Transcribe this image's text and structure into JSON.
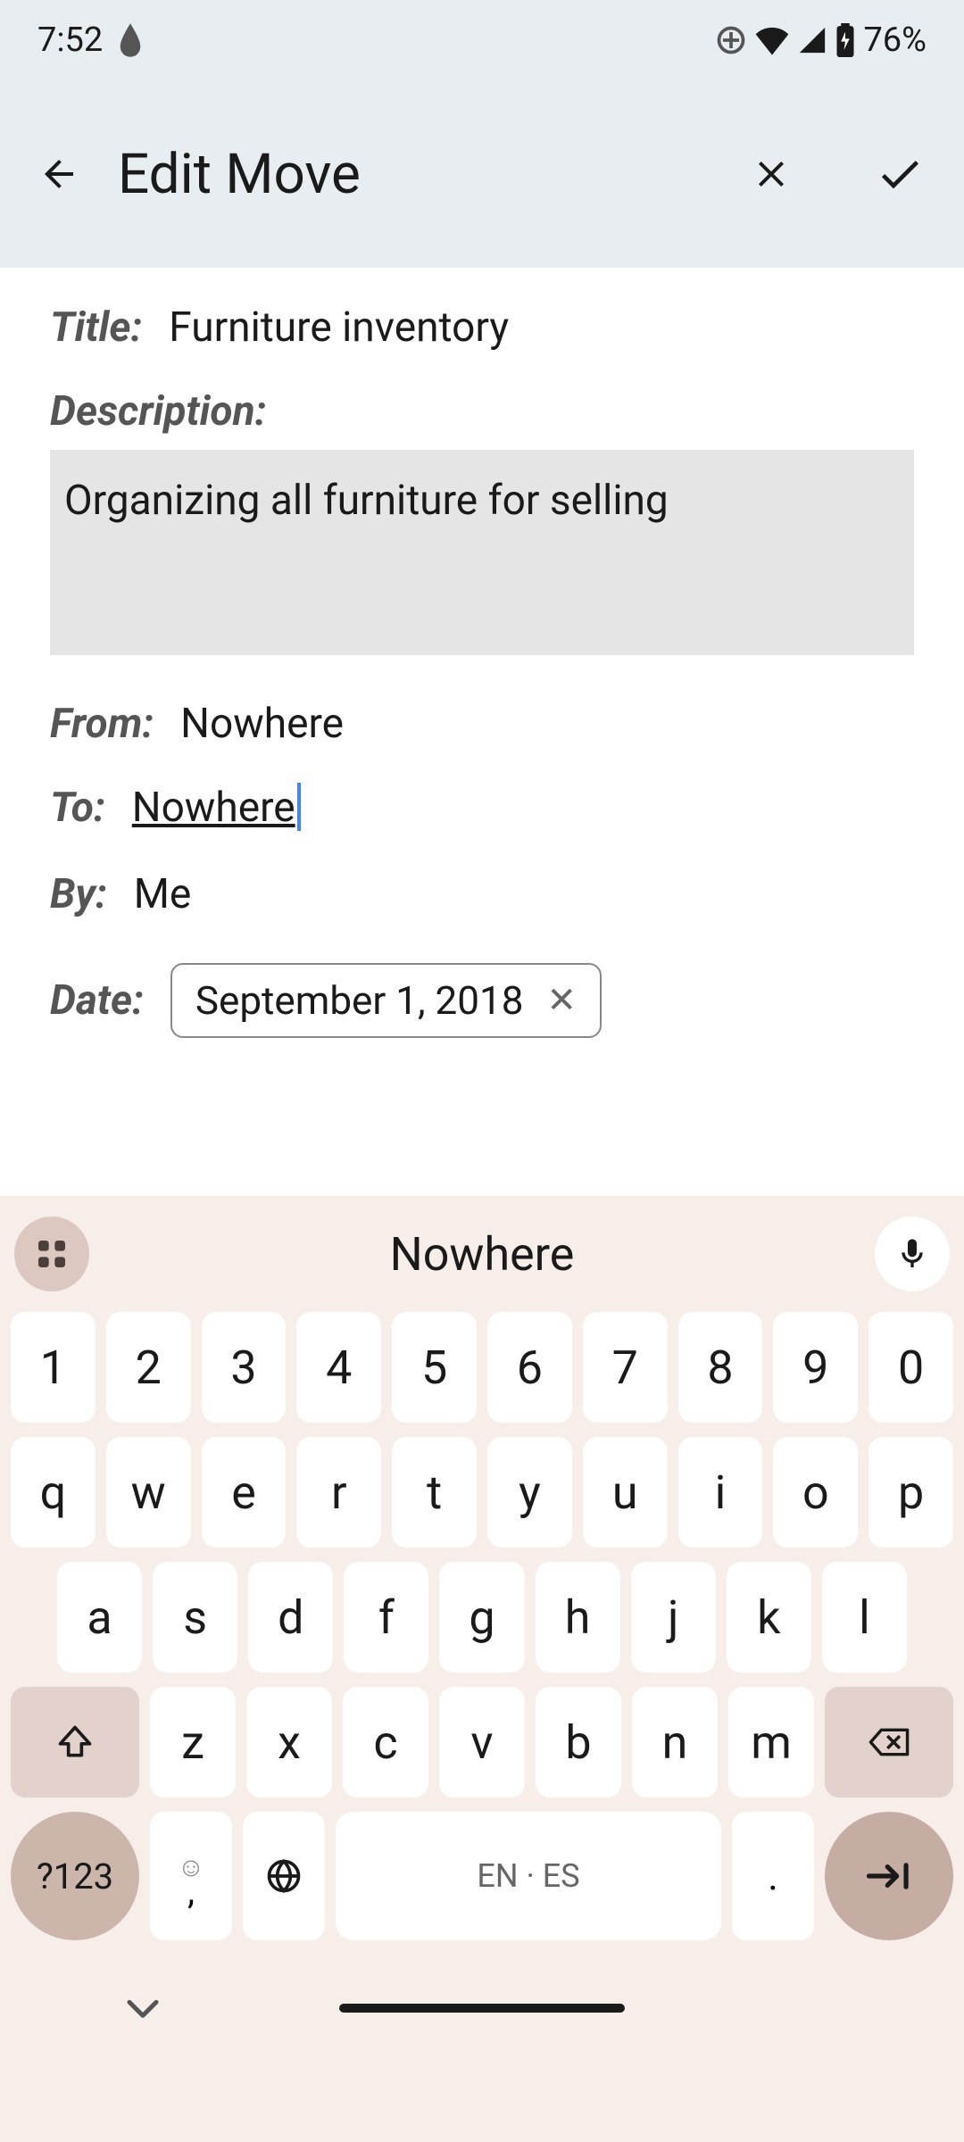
{
  "status": {
    "time": "7:52",
    "battery": "76%"
  },
  "appbar": {
    "title": "Edit Move"
  },
  "form": {
    "title_label": "Title:",
    "title_value": "Furniture inventory",
    "description_label": "Description:",
    "description_value": "Organizing all furniture for selling",
    "from_label": "From:",
    "from_value": "Nowhere",
    "to_label": "To:",
    "to_value": "Nowhere",
    "by_label": "By:",
    "by_value": "Me",
    "date_label": "Date:",
    "date_value": "September 1, 2018"
  },
  "keyboard": {
    "suggestion": "Nowhere",
    "row1": [
      "1",
      "2",
      "3",
      "4",
      "5",
      "6",
      "7",
      "8",
      "9",
      "0"
    ],
    "row2": [
      "q",
      "w",
      "e",
      "r",
      "t",
      "y",
      "u",
      "i",
      "o",
      "p"
    ],
    "row3": [
      "a",
      "s",
      "d",
      "f",
      "g",
      "h",
      "j",
      "k",
      "l"
    ],
    "row4": [
      "z",
      "x",
      "c",
      "v",
      "b",
      "n",
      "m"
    ],
    "symbols": "?123",
    "emoji_top": "☺",
    "emoji_bot": ",",
    "space": "EN · ES",
    "period": "."
  }
}
